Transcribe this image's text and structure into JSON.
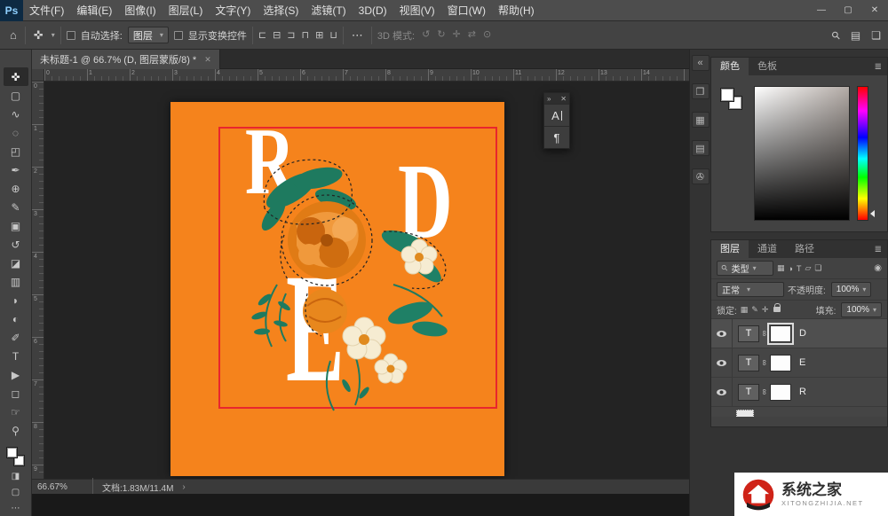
{
  "window": {
    "logo": "Ps",
    "controls": {
      "minimize": "—",
      "maximize": "▢",
      "close": "✕"
    }
  },
  "menubar": {
    "items": [
      "文件(F)",
      "编辑(E)",
      "图像(I)",
      "图层(L)",
      "文字(Y)",
      "选择(S)",
      "滤镜(T)",
      "3D(D)",
      "视图(V)",
      "窗口(W)",
      "帮助(H)"
    ]
  },
  "optionsbar": {
    "home_icon": "⌂",
    "tool_icon": "✜",
    "caret": "▾",
    "auto_select_label": "自动选择:",
    "auto_select_value": "图层",
    "show_transform_label": "显示变换控件",
    "align_icons": [
      "⊏",
      "⊟",
      "⊐",
      "⊓",
      "⊞",
      "⊔"
    ],
    "more_icon": "⋯",
    "mode_3d_label": "3D 模式:",
    "mode_3d_icons": [
      "↺",
      "↻",
      "✛",
      "⇄",
      "⊙"
    ],
    "search_icon": "⚲",
    "workspace_icon": "▤",
    "dock_icon": "❏"
  },
  "doc_tab": {
    "title": "未标题-1 @ 66.7% (D, 图层蒙版/8) *",
    "close_icon": "✕"
  },
  "tools": [
    {
      "glyph": "✜"
    },
    {
      "glyph": "▢"
    },
    {
      "glyph": "∿"
    },
    {
      "glyph": "◌"
    },
    {
      "glyph": "◰"
    },
    {
      "glyph": "✒"
    },
    {
      "glyph": "⊕"
    },
    {
      "glyph": "✎"
    },
    {
      "glyph": "▣"
    },
    {
      "glyph": "↺"
    },
    {
      "glyph": "◪"
    },
    {
      "glyph": "▥"
    },
    {
      "glyph": "◗"
    },
    {
      "glyph": "◐"
    },
    {
      "glyph": "✐"
    },
    {
      "glyph": "T"
    },
    {
      "glyph": "▶"
    },
    {
      "glyph": "◻"
    },
    {
      "glyph": "☞"
    },
    {
      "glyph": "⚲"
    }
  ],
  "toolbar_bottom": {
    "quick_mask_icon": "◨",
    "screen_mode_icon": "▢",
    "more_icon": "⋯"
  },
  "rulers": {
    "top": [
      "0",
      "1",
      "2",
      "3",
      "4",
      "5",
      "6",
      "7",
      "8",
      "9",
      "10",
      "11",
      "12",
      "13",
      "14"
    ],
    "left": [
      "0",
      "1",
      "2",
      "3",
      "4",
      "5",
      "6",
      "7",
      "8",
      "9"
    ]
  },
  "artwork": {
    "letters": [
      "R",
      "D",
      "E"
    ]
  },
  "float_panel": {
    "collapse_icon": "»",
    "close_icon": "✕",
    "char_icon": "A",
    "paragraph_icon": "¶"
  },
  "dock_icons": [
    {
      "glyph": "«"
    },
    {
      "glyph": "❐"
    },
    {
      "glyph": "▦"
    },
    {
      "glyph": "▤"
    },
    {
      "glyph": "✇"
    }
  ],
  "color_panel": {
    "tabs": [
      "颜色",
      "色板"
    ],
    "menu_icon": "≣"
  },
  "layers_panel": {
    "tabs": [
      "图层",
      "通道",
      "路径"
    ],
    "menu_icon": "≣",
    "filter": {
      "search_icon": "⚲",
      "label": "类型",
      "icons": [
        "▦",
        "◑",
        "T",
        "▱",
        "❏"
      ],
      "toggle_icon": "◉"
    },
    "blend_mode": "正常",
    "opacity_label": "不透明度:",
    "opacity_value": "100%",
    "lock_label": "锁定:",
    "lock_icons": [
      "▦",
      "✎",
      "✛"
    ],
    "fill_label": "填充:",
    "fill_value": "100%",
    "layer_type_icon": "T",
    "link_icon": "∞",
    "layers": [
      {
        "name": "D"
      },
      {
        "name": "E"
      },
      {
        "name": "R"
      }
    ]
  },
  "statusbar": {
    "zoom": "66.67%",
    "doc_info": "文档:1.83M/11.4M",
    "chevron": "›"
  },
  "watermark": {
    "title": "系统之家",
    "domain": "XITONGZHIJIA.NET"
  },
  "colors": {
    "canvas_orange": "#f5831c",
    "selection_red": "#e8262d",
    "leaf_teal": "#1e7a5f",
    "flower_orange": "#e07b15",
    "cream": "#f6ecd2"
  }
}
